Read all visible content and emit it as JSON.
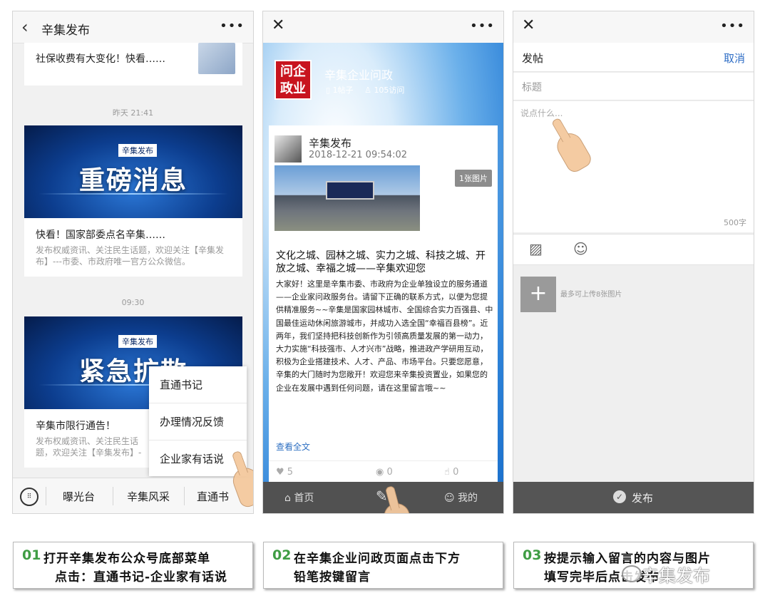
{
  "phone1": {
    "title": "辛集发布",
    "top_message": "社保收费有大变化！快看……",
    "time1": "昨天 21:41",
    "card1": {
      "tag": "辛集发布",
      "banner_text": "重磅消息",
      "headline": "快看！国家部委点名辛集……",
      "summary": "发布权威资讯、关注民生话题，欢迎关注【辛集发布】---市委、市政府唯一官方公众微信。"
    },
    "time2": "09:30",
    "card2": {
      "tag": "辛集发布",
      "banner_text": "紧急扩散",
      "headline": "辛集市限行通告！",
      "summary": "发布权威资讯、关注民生话题，欢迎关注【辛集发布】---市委、市政府唯一官方公众微信。"
    },
    "popup_items": [
      "直通书记",
      "办理情况反馈",
      "企业家有话说"
    ],
    "menu_items": [
      "曝光台",
      "辛集风采",
      "直通书"
    ]
  },
  "phone2": {
    "seal_text": "问企政业",
    "page_title": "辛集企业问政",
    "posts_count": "1帖子",
    "visits_count": "105访问",
    "author": "辛集发布",
    "date": "2018-12-21 09:54:02",
    "image_count": "1张图片",
    "headline": "文化之城、园林之城、实力之城、科技之城、开放之城、幸福之城——辛集欢迎您",
    "body": "大家好！这里是辛集市委、市政府为企业单独设立的服务通道——企业家问政服务台。请留下正确的联系方式，以便为您提供精准服务~~辛集是国家园林城市、全国综合实力百强县、中国最佳运动休闲旅游城市，并成功入选全国“幸福百县榜”。近两年，我们坚持把科技创新作为引领高质量发展的第一动力，大力实施“科技强市、人才兴市”战略，推进政产学研用互动，积极为企业搭建技术、人才、产品、市场平台。只要您愿意，辛集的大门随时为您敞开！欢迎您来辛集投资置业，如果您的企业在发展中遇到任何问题，请在这里留言哦~~",
    "read_all": "查看全文",
    "likes": "5",
    "comments": "0",
    "thumbs": "0",
    "tab_home": "首页",
    "tab_mine": "我的"
  },
  "phone3": {
    "header": "发帖",
    "cancel": "取消",
    "title_placeholder": "标题",
    "content_placeholder": "说点什么...",
    "char_limit": "500字",
    "upload_tip": "最多可上传8张图片",
    "publish": "发布"
  },
  "captions": [
    {
      "num": "01",
      "line1": "打开辛集发布公众号底部菜单",
      "line2": "点击：直通书记-企业家有话说"
    },
    {
      "num": "02",
      "line1": "在辛集企业问政页面点击下方",
      "line2": "铅笔按键留言"
    },
    {
      "num": "03",
      "line1": "按提示输入留言的内容与图片",
      "line2": "填写完毕后点击发布"
    }
  ],
  "watermark": "辛集发布",
  "colors": {
    "accent_blue": "#2f6ec5",
    "step_green": "#3f9d44",
    "seal_red": "#c8141e"
  }
}
